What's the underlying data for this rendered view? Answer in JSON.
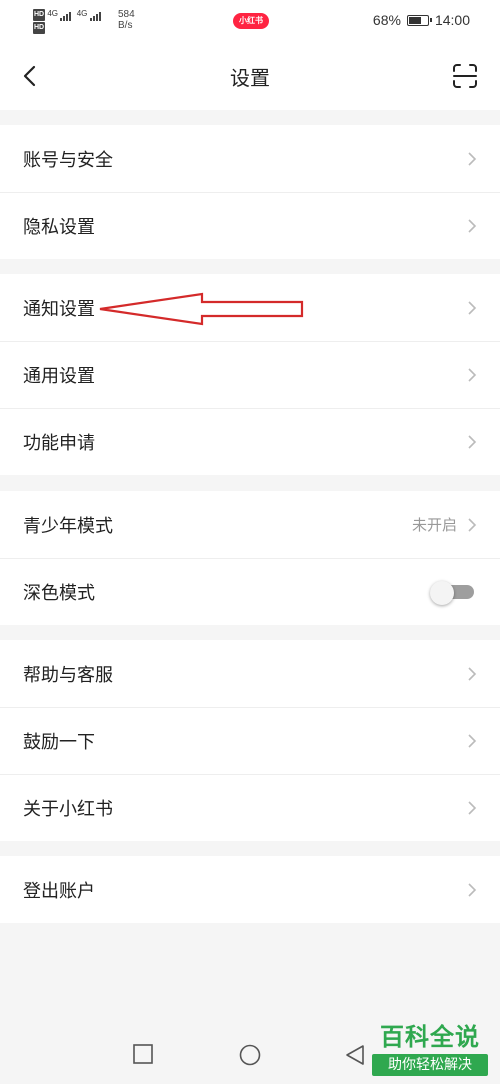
{
  "status_bar": {
    "hd": "HD",
    "signal": "4G",
    "net_speed_value": "584",
    "net_speed_unit": "B/s",
    "app_badge": "小红书",
    "battery_percent": "68%",
    "battery_level": 0.68,
    "time": "14:00"
  },
  "header": {
    "title": "设置"
  },
  "groups": [
    {
      "items": [
        {
          "label": "账号与安全"
        },
        {
          "label": "隐私设置"
        }
      ]
    },
    {
      "items": [
        {
          "label": "通知设置"
        },
        {
          "label": "通用设置"
        },
        {
          "label": "功能申请"
        }
      ]
    },
    {
      "items": [
        {
          "label": "青少年模式",
          "value": "未开启"
        },
        {
          "label": "深色模式",
          "toggle_on": false
        }
      ]
    },
    {
      "items": [
        {
          "label": "帮助与客服"
        },
        {
          "label": "鼓励一下"
        },
        {
          "label": "关于小红书"
        }
      ]
    },
    {
      "items": [
        {
          "label": "登出账户"
        }
      ]
    }
  ],
  "watermark": {
    "title": "百科全说",
    "subtitle": "助你轻松解决"
  },
  "colors": {
    "brand": "#ff2442",
    "annotation_arrow": "#d42a2a",
    "watermark_green": "#2fa84f"
  }
}
